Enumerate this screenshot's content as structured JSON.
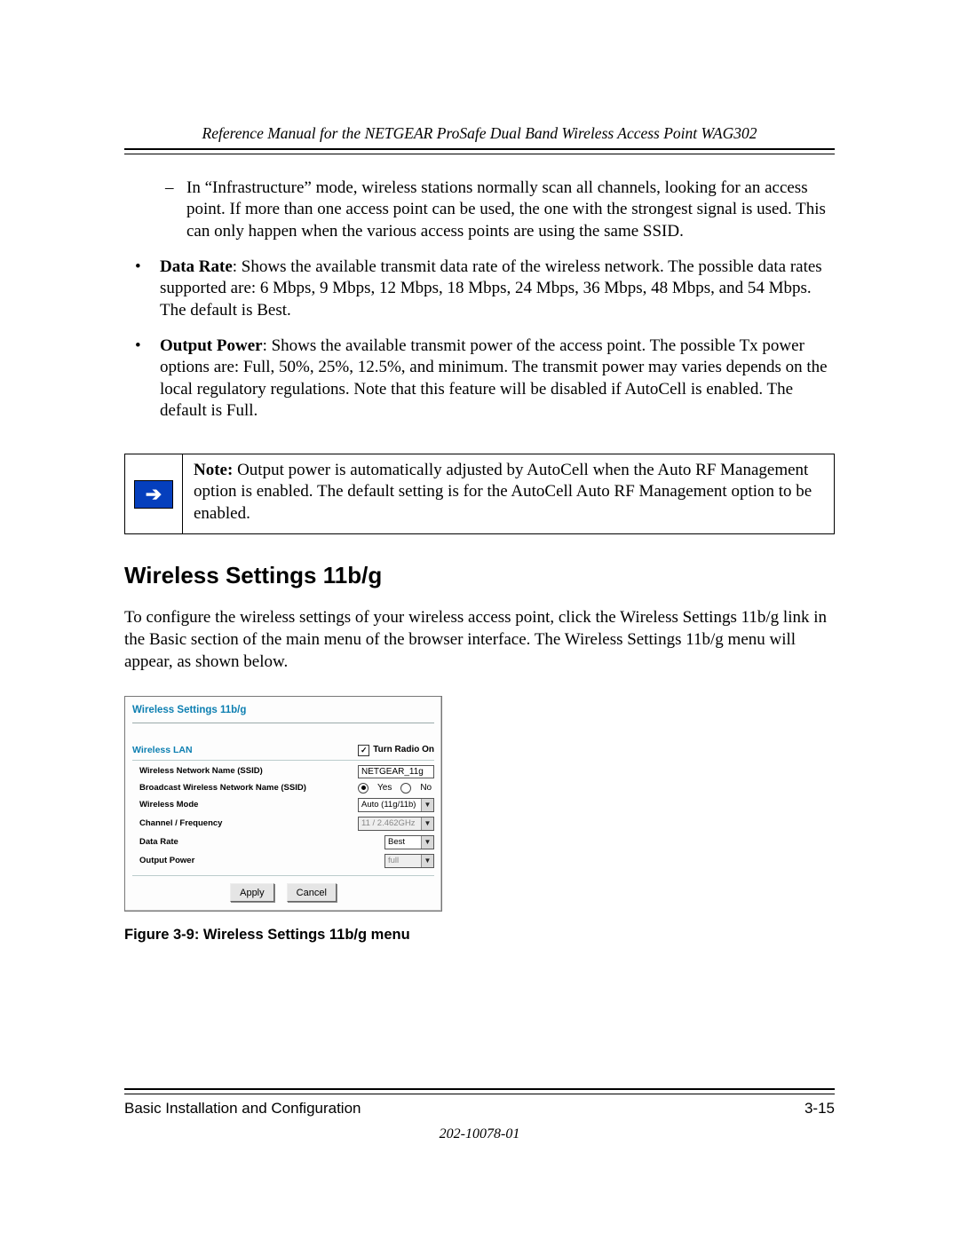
{
  "header": {
    "running_title": "Reference Manual for the NETGEAR ProSafe Dual Band Wireless Access Point WAG302"
  },
  "body": {
    "dash_item": "In “Infrastructure” mode, wireless stations normally scan all channels, looking for an access point. If more than one access point can be used, the one with the strongest signal is used. This can only happen when the various access points are using the same SSID.",
    "bullet_data_rate_label": "Data Rate",
    "bullet_data_rate_text": ": Shows the available transmit data rate of the wireless network. The possible data rates supported are: 6 Mbps, 9 Mbps, 12 Mbps, 18 Mbps, 24 Mbps, 36 Mbps, 48 Mbps, and 54 Mbps. The default is Best.",
    "bullet_output_label": "Output Power",
    "bullet_output_text": ": Shows the available transmit power of the access point. The possible Tx power options are: Full, 50%, 25%, 12.5%, and minimum. The transmit power may varies depends on the local regulatory regulations. Note that this feature will be disabled if AutoCell is enabled. The default is Full.",
    "note_label": "Note:",
    "note_text": " Output power is automatically adjusted by AutoCell when the Auto RF Management option is enabled. The default setting is for the AutoCell Auto RF Management option to be enabled.",
    "section_title": "Wireless Settings 11b/g",
    "intro": "To configure the wireless settings of your wireless access point, click the Wireless Settings 11b/g link in the Basic section of the main menu of the browser interface. The Wireless Settings 11b/g menu will appear, as shown below."
  },
  "panel": {
    "title": "Wireless Settings 11b/g",
    "subtitle": "Wireless LAN",
    "turn_radio_label": "Turn Radio On",
    "turn_radio_checked": "✓",
    "rows": {
      "ssid_label": "Wireless Network Name (SSID)",
      "ssid_value": "NETGEAR_11g",
      "broadcast_label": "Broadcast Wireless Network Name (SSID)",
      "broadcast_yes": "Yes",
      "broadcast_no": "No",
      "mode_label": "Wireless Mode",
      "mode_value": "Auto (11g/11b)",
      "channel_label": "Channel / Frequency",
      "channel_value": "11 / 2.462GHz",
      "rate_label": "Data Rate",
      "rate_value": "Best",
      "power_label": "Output Power",
      "power_value": "full"
    },
    "buttons": {
      "apply": "Apply",
      "cancel": "Cancel"
    }
  },
  "figure_caption": "Figure 3-9: Wireless Settings 11b/g menu",
  "footer": {
    "left": "Basic Installation and Configuration",
    "right": "3-15",
    "docnum": "202-10078-01"
  }
}
